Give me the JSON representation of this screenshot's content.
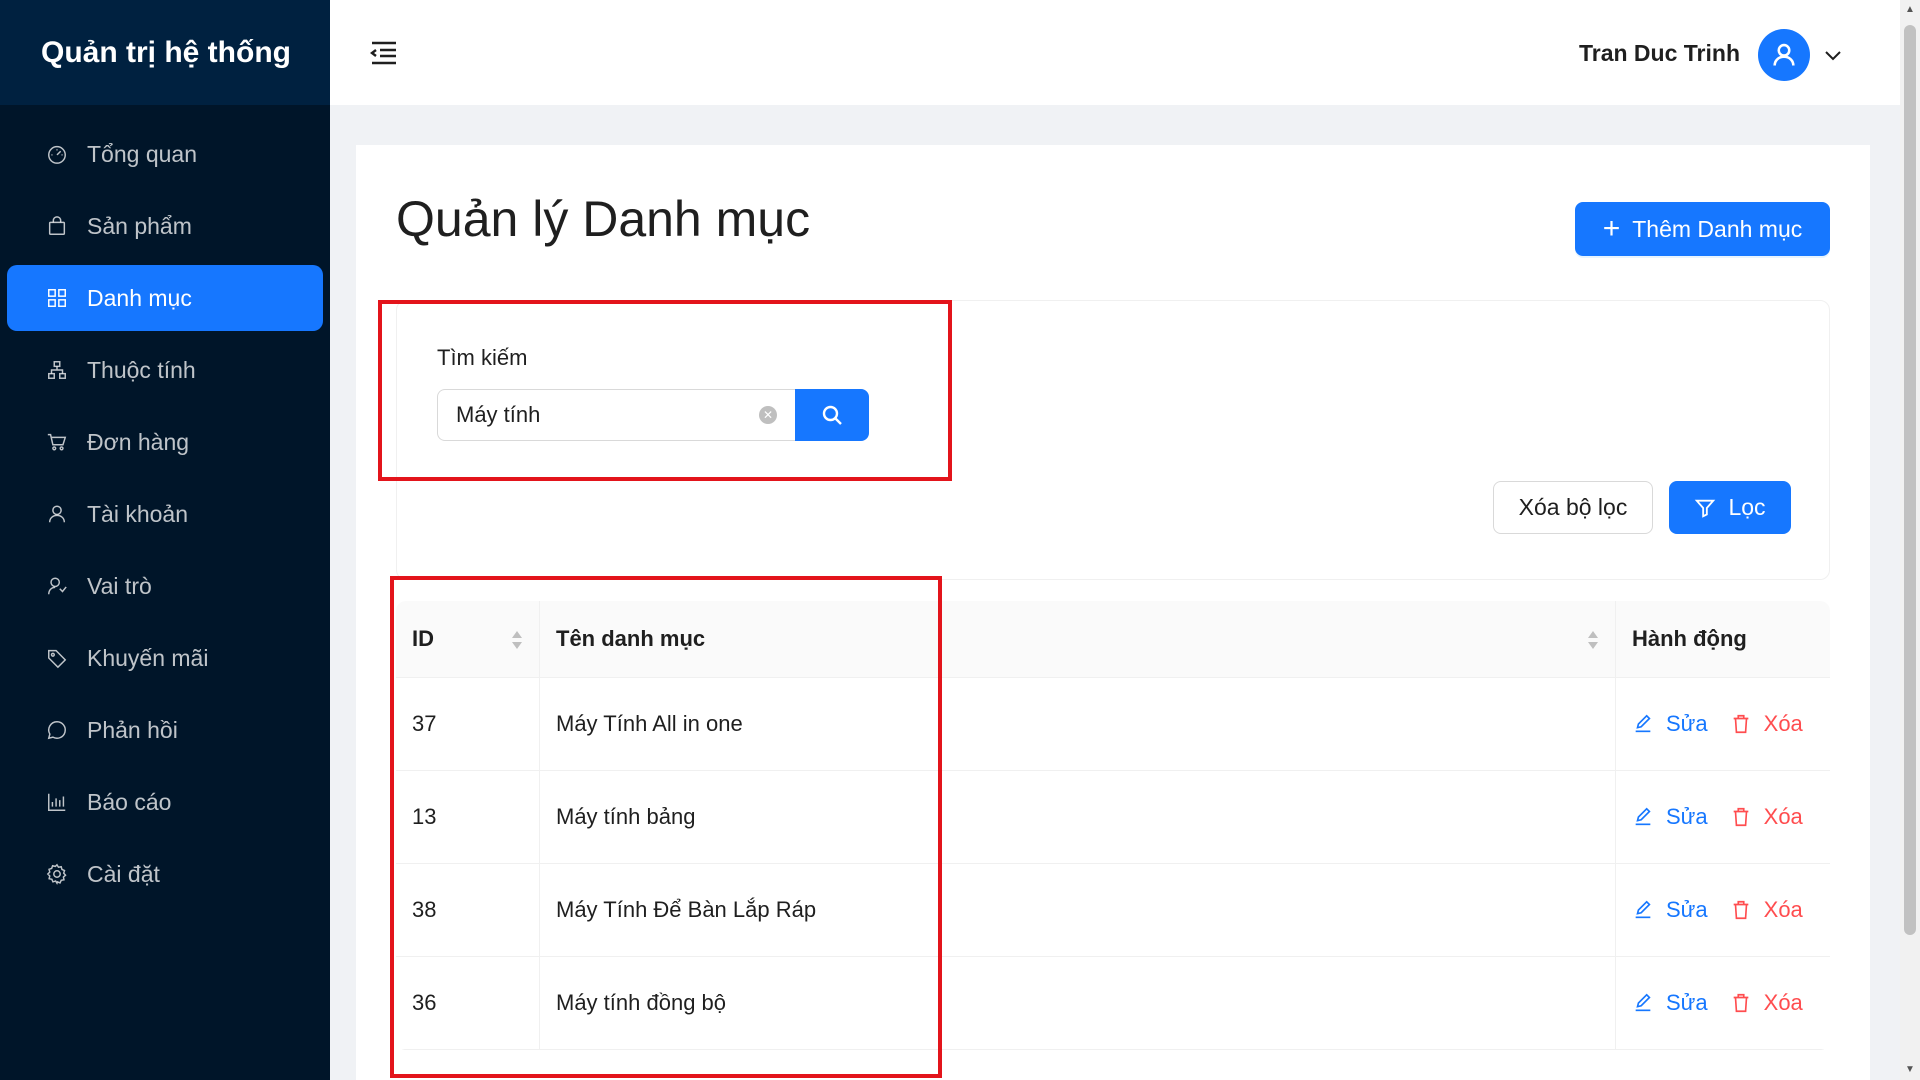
{
  "brand": {
    "title": "Quản trị hệ thống"
  },
  "sidebar": {
    "items": [
      {
        "label": "Tổng quan",
        "icon": "dashboard-icon"
      },
      {
        "label": "Sản phẩm",
        "icon": "shopping-bag-icon"
      },
      {
        "label": "Danh mục",
        "icon": "grid-icon",
        "active": true
      },
      {
        "label": "Thuộc tính",
        "icon": "cluster-icon"
      },
      {
        "label": "Đơn hàng",
        "icon": "cart-icon"
      },
      {
        "label": "Tài khoản",
        "icon": "user-icon"
      },
      {
        "label": "Vai trò",
        "icon": "users-role-icon"
      },
      {
        "label": "Khuyến mãi",
        "icon": "tag-icon"
      },
      {
        "label": "Phản hồi",
        "icon": "comment-icon"
      },
      {
        "label": "Báo cáo",
        "icon": "bar-chart-icon"
      },
      {
        "label": "Cài đặt",
        "icon": "gear-icon"
      }
    ]
  },
  "header": {
    "user_name": "Tran Duc Trinh"
  },
  "main": {
    "title": "Quản lý Danh mục",
    "add_button": "Thêm Danh mục",
    "search": {
      "label": "Tìm kiếm",
      "value": "Máy tính"
    },
    "clear_filter_button": "Xóa bộ lọc",
    "filter_button": "Lọc",
    "table": {
      "headers": {
        "id": "ID",
        "name": "Tên danh mục",
        "action": "Hành động"
      },
      "rows": [
        {
          "id": "37",
          "name": "Máy Tính All in one"
        },
        {
          "id": "13",
          "name": "Máy tính bảng"
        },
        {
          "id": "38",
          "name": "Máy Tính Để Bàn Lắp Ráp"
        },
        {
          "id": "36",
          "name": "Máy tính đồng bộ"
        }
      ],
      "edit_label": "Sửa",
      "delete_label": "Xóa"
    }
  },
  "colors": {
    "primary": "#1677ff",
    "sidebar_bg": "#001529",
    "danger": "#ff4d4f",
    "highlight": "#e3141b"
  }
}
